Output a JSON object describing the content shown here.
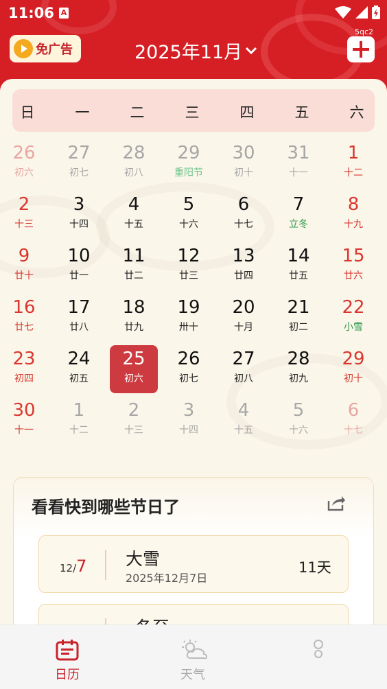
{
  "status_bar": {
    "time": "11:06",
    "notification_icon": "A"
  },
  "header": {
    "ad_button_label": "免广告",
    "month_title": "2025年11月",
    "add_label": "5qc2"
  },
  "weekdays": [
    "日",
    "一",
    "二",
    "三",
    "四",
    "五",
    "六"
  ],
  "calendar": {
    "weeks": [
      [
        {
          "d": "26",
          "l": "初六",
          "t": "other-weekend"
        },
        {
          "d": "27",
          "l": "初七",
          "t": "other"
        },
        {
          "d": "28",
          "l": "初八",
          "t": "other"
        },
        {
          "d": "29",
          "l": "重阳节",
          "t": "other-festival"
        },
        {
          "d": "30",
          "l": "初十",
          "t": "other"
        },
        {
          "d": "31",
          "l": "十一",
          "t": "other"
        },
        {
          "d": "1",
          "l": "十二",
          "t": "weekend"
        }
      ],
      [
        {
          "d": "2",
          "l": "十三",
          "t": "weekend"
        },
        {
          "d": "3",
          "l": "十四",
          "t": "normal"
        },
        {
          "d": "4",
          "l": "十五",
          "t": "normal"
        },
        {
          "d": "5",
          "l": "十六",
          "t": "normal"
        },
        {
          "d": "6",
          "l": "十七",
          "t": "normal"
        },
        {
          "d": "7",
          "l": "立冬",
          "t": "term"
        },
        {
          "d": "8",
          "l": "十九",
          "t": "weekend"
        }
      ],
      [
        {
          "d": "9",
          "l": "廿十",
          "t": "weekend"
        },
        {
          "d": "10",
          "l": "廿一",
          "t": "normal"
        },
        {
          "d": "11",
          "l": "廿二",
          "t": "normal"
        },
        {
          "d": "12",
          "l": "廿三",
          "t": "normal"
        },
        {
          "d": "13",
          "l": "廿四",
          "t": "normal"
        },
        {
          "d": "14",
          "l": "廿五",
          "t": "normal"
        },
        {
          "d": "15",
          "l": "廿六",
          "t": "weekend"
        }
      ],
      [
        {
          "d": "16",
          "l": "廿七",
          "t": "weekend"
        },
        {
          "d": "17",
          "l": "廿八",
          "t": "normal"
        },
        {
          "d": "18",
          "l": "廿九",
          "t": "normal"
        },
        {
          "d": "19",
          "l": "卅十",
          "t": "normal"
        },
        {
          "d": "20",
          "l": "十月",
          "t": "normal"
        },
        {
          "d": "21",
          "l": "初二",
          "t": "normal"
        },
        {
          "d": "22",
          "l": "小雪",
          "t": "weekend-term"
        }
      ],
      [
        {
          "d": "23",
          "l": "初四",
          "t": "weekend"
        },
        {
          "d": "24",
          "l": "初五",
          "t": "normal"
        },
        {
          "d": "25",
          "l": "初六",
          "t": "selected"
        },
        {
          "d": "26",
          "l": "初七",
          "t": "normal"
        },
        {
          "d": "27",
          "l": "初八",
          "t": "normal"
        },
        {
          "d": "28",
          "l": "初九",
          "t": "normal"
        },
        {
          "d": "29",
          "l": "初十",
          "t": "weekend"
        }
      ],
      [
        {
          "d": "30",
          "l": "十一",
          "t": "weekend"
        },
        {
          "d": "1",
          "l": "十二",
          "t": "other"
        },
        {
          "d": "2",
          "l": "十三",
          "t": "other"
        },
        {
          "d": "3",
          "l": "十四",
          "t": "other"
        },
        {
          "d": "4",
          "l": "十五",
          "t": "other"
        },
        {
          "d": "5",
          "l": "十六",
          "t": "other"
        },
        {
          "d": "6",
          "l": "十七",
          "t": "other-weekend"
        }
      ]
    ]
  },
  "festivals": {
    "title": "看看快到哪些节日了",
    "items": [
      {
        "month": "12",
        "day": "7",
        "name": "大雪",
        "full_date": "2025年12月7日",
        "days_left": "11天"
      },
      {
        "month": "",
        "day": "",
        "name": "冬至",
        "full_date": "",
        "days_left": ""
      }
    ]
  },
  "bottom_nav": [
    {
      "label": "日历",
      "icon": "calendar-icon",
      "active": true
    },
    {
      "label": "天气",
      "icon": "weather-icon",
      "active": false
    },
    {
      "label": "",
      "icon": "profile-icon",
      "active": false
    }
  ],
  "colors": {
    "brand_red": "#d51f25",
    "weekend_red": "#d9372f",
    "term_green": "#2e9a4a",
    "festival_green": "#6cc38a",
    "selected_bg": "#cd3a40",
    "muted_gray": "#a7a7a7",
    "muted_pink": "#e8a7a3"
  }
}
